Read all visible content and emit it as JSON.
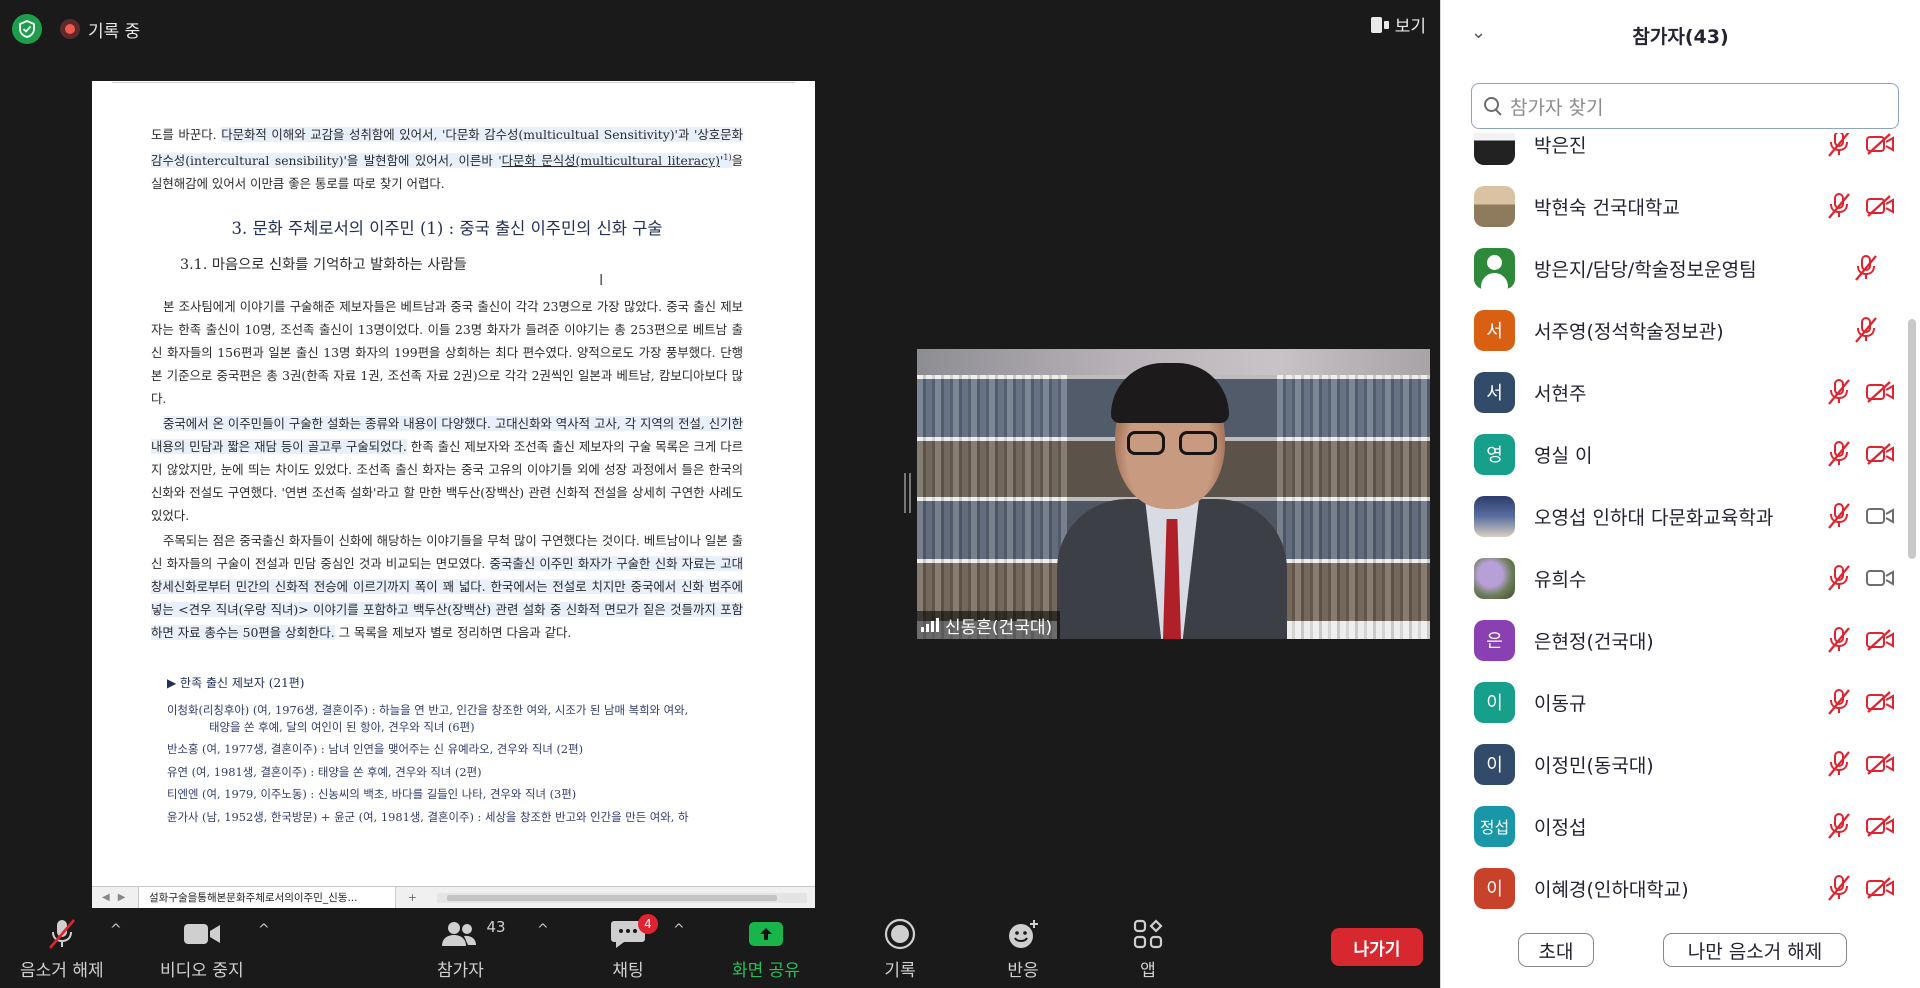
{
  "topbar": {
    "recording_label": "기록 중",
    "view_label": "보기"
  },
  "document": {
    "intro_text": "도를 바꾼다. ",
    "intro_hl1": "다문화적 이해와 교감을 성취함에 있어서, '다문화 감수성(multicultual Sensitivity)'과 '상호문화 감수성(intercultural sensibility)'을 발현함에 있어서, 이른바 '",
    "intro_ul": "다문화 문식성(multicultural literacy)",
    "intro_sup": "1)",
    "intro_rest": "을 실현해감에 있어서 이만큼 좋은 통로를 따로 찾기 어렵다.",
    "heading3": "3. 문화 주체로서의 이주민 (1) : 중국 출신 이주민의 신화 구술",
    "heading31": "3.1. 마음으로 신화를 기억하고 발화하는 사람들",
    "para1": "본 조사팀에게 이야기를 구술해준 제보자들은 베트남과 중국 출신이 각각 23명으로 가장 많았다. 중국 출신 제보자는 한족 출신이 10명, 조선족 출신이 13명이었다. 이들 23명 화자가 들려준 이야기는 총 253편으로 베트남 출신 화자들의 156편과 일본 출신 13명 화자의 199편을 상회하는 최다 편수였다. 양적으로도 가장 풍부했다. 단행본 기준으로 중국편은 총 3권(한족 자료 1권, 조선족 자료 2권)으로 각각 2권씩인 일본과 베트남, 캄보디아보다 많다.",
    "para2_hl": "중국에서 온 이주민들이 구술한 설화는 종류와 내용이 다양했다. 고대신화와 역사적 고사, 각 지역의 전설, 신기한 내용의 민담과 짧은 재담 등이 골고루 구술되었다.",
    "para2_rest": " 한족 출신 제보자와 조선족 출신 제보자의 구술 목록은 크게 다르지 않았지만, 눈에 띄는 차이도 있었다. 조선족 출신 화자는 중국 고유의 이야기들 외에 성장 과정에서 들은 한국의 신화와 전설도 구연했다. '연변 조선족 설화'라고 할 만한 백두산(장백산) 관련 신화적 전설을 상세히 구연한 사례도 있었다.",
    "para3_a": "주목되는 점은 중국출신 화자들이 신화에 해당하는 이야기들을 무척 많이 구연했다는 것이다. 베트남이나 일본 출신 화자들의 구술이 전설과 민담 중심인 것과 비교되는 면모였다. ",
    "para3_hl": "중국출신 이주민 화자가 구술한 신화 자료는 고대 창세신화로부터 민간의 신화적 전승에 이르기까지 폭이 꽤 넓다. 한국에서는 전설로 치지만 중국에서 신화 범주에 넣는 <견우 직녀(우랑 직녀)> 이야기를 포함하고 백두산(장백산) 관련 설화 중 신화적 면모가 짙은 것들까지 포함하면 자료 총수는 50편을 상회한다.",
    "para3_rest": " 그 목록을 제보자 별로 정리하면 다음과 같다.",
    "section_title": "▶ 한족 출신 제보자 (21편)",
    "entries": [
      "이청화(리칭후아) (여, 1976생, 결혼이주) : 하늘을 연 반고, 인간을 창조한 여와, 시조가 된 남매 복희와 여와,",
      "태양을 쏜 후예, 달의 여인이 된 항아, 견우와 직녀 (6편)",
      "반소홍 (여, 1977생, 결혼이주) : 남녀 인연을 맺어주는 신 유예라오, 견우와 직녀 (2편)",
      "유연 (여, 1981생, 결혼이주) : 태양을 쏜 후예, 견우와 직녀 (2편)",
      "티엔엔 (여, 1979, 이주노동) : 신농씨의 백초, 바다를 길들인 나타, 견우와 직녀 (3편)",
      "윤가사 (남, 1952생, 한국방문) + 윤군 (여, 1981생, 결혼이주) : 세상을 창조한 반고와 인간을 만든 여와, 하"
    ],
    "sheet_tab": "설화구술을통해본문화주체로서의이주민_신동..."
  },
  "video": {
    "participant_name": "신동흔(건국대)"
  },
  "toolbar": {
    "unmute_label": "음소거 해제",
    "video_label": "비디오 중지",
    "participants_label": "참가자",
    "participants_count": "43",
    "chat_label": "채팅",
    "chat_badge": "4",
    "share_label": "화면 공유",
    "record_label": "기록",
    "reactions_label": "반응",
    "apps_label": "앱",
    "leave_label": "나가기"
  },
  "panel": {
    "title": "참가자(43)",
    "search_placeholder": "참가자 찾기",
    "participants": [
      {
        "name": "박은진",
        "avatar": "",
        "avatar_style": "photo0",
        "muted": true,
        "video": "off"
      },
      {
        "name": "박현숙 건국대학교",
        "avatar": "",
        "avatar_style": "photo1",
        "muted": true,
        "video": "off"
      },
      {
        "name": "방은지/담당/학술정보운영팀",
        "avatar": "",
        "avatar_style": "person",
        "muted": true,
        "video": "none"
      },
      {
        "name": "서주영(정석학술정보관)",
        "avatar": "서",
        "avatar_color": "#d95f12",
        "muted": true,
        "video": "none"
      },
      {
        "name": "서현주",
        "avatar": "서",
        "avatar_color": "#334b6b",
        "muted": true,
        "video": "off"
      },
      {
        "name": "영실 이",
        "avatar": "영",
        "avatar_color": "#169f8a",
        "muted": true,
        "video": "off"
      },
      {
        "name": "오영섭 인하대 다문화교육학과",
        "avatar": "",
        "avatar_style": "photo2",
        "muted": true,
        "video": "on"
      },
      {
        "name": "유희수",
        "avatar": "",
        "avatar_style": "photo3",
        "muted": true,
        "video": "on"
      },
      {
        "name": "은현정(건국대)",
        "avatar": "은",
        "avatar_color": "#8a3fb2",
        "muted": true,
        "video": "off"
      },
      {
        "name": "이동규",
        "avatar": "이",
        "avatar_color": "#169f8a",
        "muted": true,
        "video": "off"
      },
      {
        "name": "이정민(동국대)",
        "avatar": "이",
        "avatar_color": "#334b6b",
        "muted": true,
        "video": "off"
      },
      {
        "name": "이정섭",
        "avatar": "정섭",
        "avatar_color": "#1997a8",
        "muted": true,
        "video": "off"
      },
      {
        "name": "이혜경(인하대학교)",
        "avatar": "이",
        "avatar_color": "#c8412a",
        "muted": true,
        "video": "off"
      }
    ],
    "invite_label": "초대",
    "unmute_me_label": "나만 음소거 해제"
  }
}
